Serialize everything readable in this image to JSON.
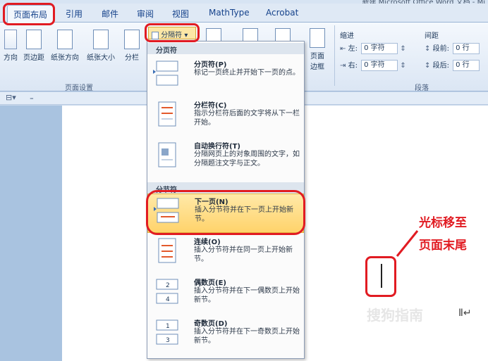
{
  "window": {
    "title": "新建 Microsoft Office Word 文档 - Mi"
  },
  "tabs": [
    "页面布局",
    "引用",
    "邮件",
    "审阅",
    "视图",
    "MathType",
    "Acrobat"
  ],
  "ribbon": {
    "page_setup": {
      "buttons": [
        "方向",
        "页边距",
        "纸张方向",
        "纸张大小",
        "分栏"
      ],
      "label": "页面设置"
    },
    "breaks_button": "分隔符",
    "page_border_top": "页面",
    "page_border_bottom": "边框",
    "paragraph": {
      "indent_label": "缩进",
      "spacing_label": "间距",
      "left_label": "左:",
      "left_value": "0 字符",
      "right_label": "右:",
      "right_value": "0 字符",
      "before_label": "段前:",
      "before_value": "0 行",
      "after_label": "段后:",
      "after_value": "0 行",
      "group_label": "段落"
    }
  },
  "menu": {
    "page_breaks_header": "分页符",
    "section_breaks_header": "分节符",
    "items": [
      {
        "title": "分页符(P)",
        "desc": "标记一页终止并开始下一页的点。"
      },
      {
        "title": "分栏符(C)",
        "desc": "指示分栏符后面的文字将从下一栏开始。"
      },
      {
        "title": "自动换行符(T)",
        "desc": "分隔网页上的对象周围的文字，如分隔题注文字与正文。"
      },
      {
        "title": "下一页(N)",
        "desc": "插入分节符并在下一页上开始新节。"
      },
      {
        "title": "连续(O)",
        "desc": "插入分节符并在同一页上开始新节。"
      },
      {
        "title": "偶数页(E)",
        "desc": "插入分节符并在下一偶数页上开始新节。"
      },
      {
        "title": "奇数页(D)",
        "desc": "插入分节符并在下一奇数页上开始新节。"
      }
    ]
  },
  "annotation": {
    "line1": "光标移至",
    "line2": "页面末尾"
  },
  "watermark": "搜狗指南",
  "colors": {
    "accent": "#e11b22",
    "highlight": "#ffd36b",
    "ribbon": "#dbe6f4"
  }
}
